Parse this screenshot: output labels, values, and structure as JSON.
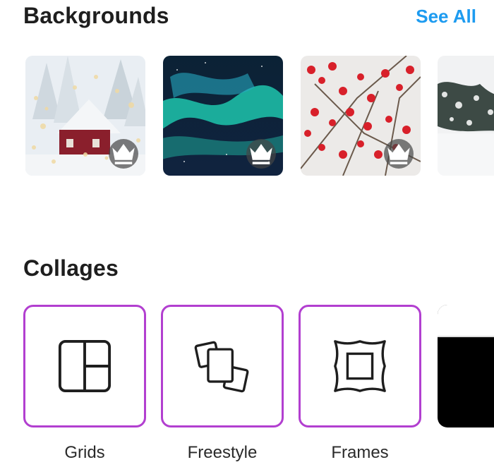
{
  "backgrounds": {
    "title": "Backgrounds",
    "see_all": "See All",
    "items": [
      {
        "name": "snowy-cabin",
        "premium": true
      },
      {
        "name": "aurora",
        "premium": true
      },
      {
        "name": "red-berries",
        "premium": true
      },
      {
        "name": "snowy-pine",
        "premium": false
      }
    ]
  },
  "collages": {
    "title": "Collages",
    "items": [
      {
        "label": "Grids",
        "icon": "grid-icon"
      },
      {
        "label": "Freestyle",
        "icon": "freestyle-icon"
      },
      {
        "label": "Frames",
        "icon": "frame-icon"
      }
    ]
  },
  "colors": {
    "accent_link": "#1d9bf0",
    "collage_border": "#b23fd0"
  }
}
